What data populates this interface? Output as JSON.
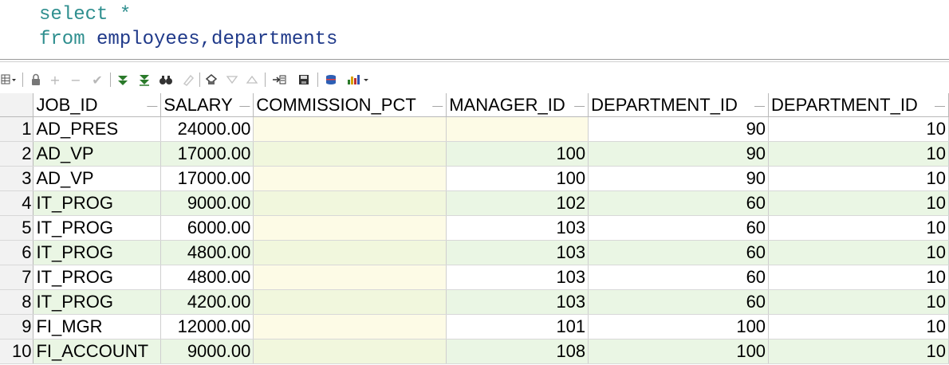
{
  "editor": {
    "line1": {
      "keyword": "select",
      "rest": " *"
    },
    "line2": {
      "keyword": "from",
      "rest": " employees,departments"
    }
  },
  "toolbar": {
    "icons": [
      "grid-menu-icon",
      "lock-icon",
      "insert-row-icon",
      "delete-row-icon",
      "post-edit-icon",
      "fetch-next-icon",
      "fetch-all-icon",
      "find-icon",
      "clear-icon",
      "query-by-example-icon",
      "filter-icon",
      "sort-icon",
      "export-icon",
      "save-icon",
      "sql-icon",
      "chart-icon"
    ]
  },
  "grid": {
    "columns": [
      "JOB_ID",
      "SALARY",
      "COMMISSION_PCT",
      "MANAGER_ID",
      "DEPARTMENT_ID",
      "DEPARTMENT_ID"
    ],
    "rows": [
      {
        "n": "1",
        "job_id": "AD_PRES",
        "salary": "24000.00",
        "commission_pct": "",
        "manager_id": "",
        "department_id": "90",
        "department_id_2": "10"
      },
      {
        "n": "2",
        "job_id": "AD_VP",
        "salary": "17000.00",
        "commission_pct": "",
        "manager_id": "100",
        "department_id": "90",
        "department_id_2": "10"
      },
      {
        "n": "3",
        "job_id": "AD_VP",
        "salary": "17000.00",
        "commission_pct": "",
        "manager_id": "100",
        "department_id": "90",
        "department_id_2": "10"
      },
      {
        "n": "4",
        "job_id": "IT_PROG",
        "salary": "9000.00",
        "commission_pct": "",
        "manager_id": "102",
        "department_id": "60",
        "department_id_2": "10"
      },
      {
        "n": "5",
        "job_id": "IT_PROG",
        "salary": "6000.00",
        "commission_pct": "",
        "manager_id": "103",
        "department_id": "60",
        "department_id_2": "10"
      },
      {
        "n": "6",
        "job_id": "IT_PROG",
        "salary": "4800.00",
        "commission_pct": "",
        "manager_id": "103",
        "department_id": "60",
        "department_id_2": "10"
      },
      {
        "n": "7",
        "job_id": "IT_PROG",
        "salary": "4800.00",
        "commission_pct": "",
        "manager_id": "103",
        "department_id": "60",
        "department_id_2": "10"
      },
      {
        "n": "8",
        "job_id": "IT_PROG",
        "salary": "4200.00",
        "commission_pct": "",
        "manager_id": "103",
        "department_id": "60",
        "department_id_2": "10"
      },
      {
        "n": "9",
        "job_id": "FI_MGR",
        "salary": "12000.00",
        "commission_pct": "",
        "manager_id": "101",
        "department_id": "100",
        "department_id_2": "10"
      },
      {
        "n": "10",
        "job_id": "FI_ACCOUNT",
        "salary": "9000.00",
        "commission_pct": "",
        "manager_id": "108",
        "department_id": "100",
        "department_id_2": "10"
      }
    ]
  }
}
